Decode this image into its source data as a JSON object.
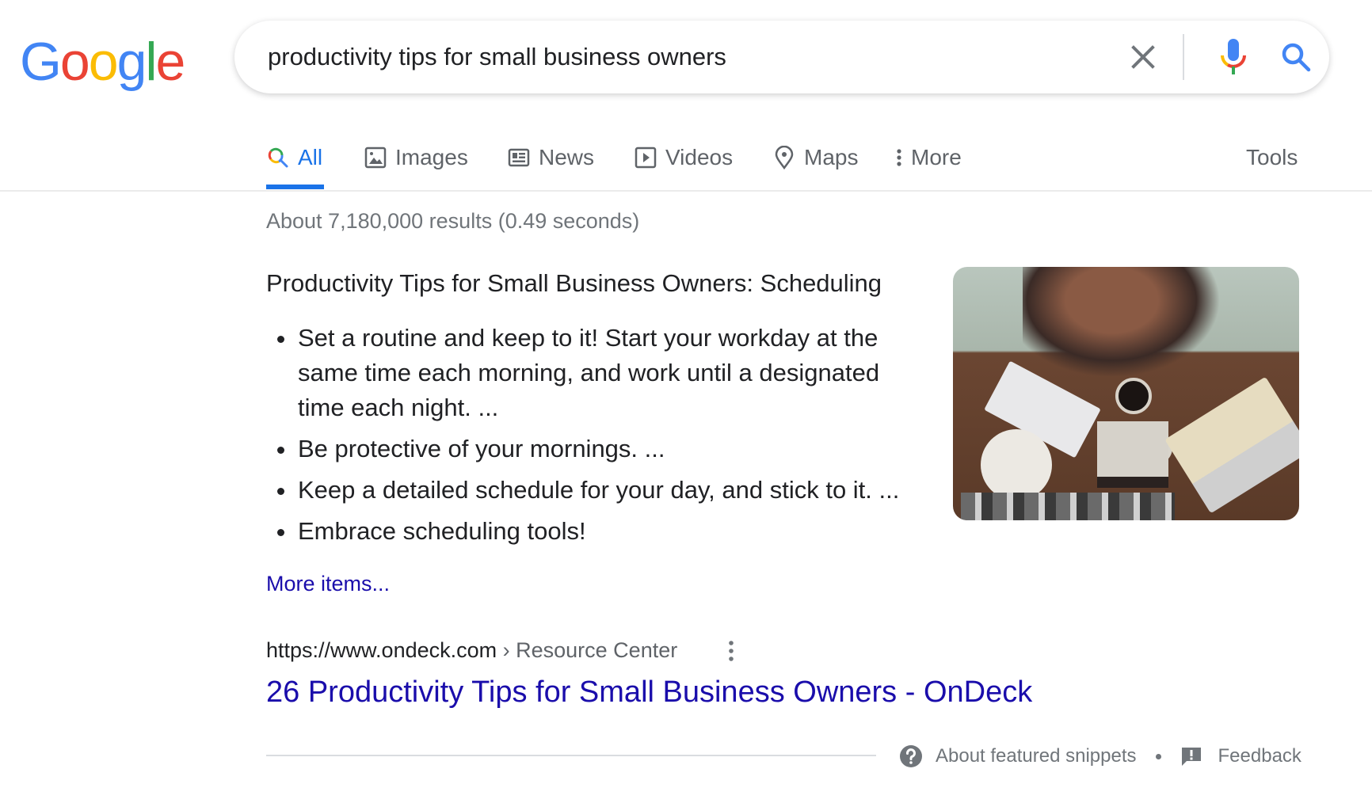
{
  "logo": {
    "letters": [
      {
        "char": "G",
        "color": "#4285f4"
      },
      {
        "char": "o",
        "color": "#ea4335"
      },
      {
        "char": "o",
        "color": "#fbbc05"
      },
      {
        "char": "g",
        "color": "#4285f4"
      },
      {
        "char": "l",
        "color": "#34a853"
      },
      {
        "char": "e",
        "color": "#ea4335"
      }
    ],
    "label": "Google"
  },
  "search": {
    "query": "productivity tips for small business owners",
    "clear_icon": "close-icon",
    "voice_icon": "microphone-icon",
    "search_icon": "search-icon"
  },
  "tabs": [
    {
      "label": "All",
      "icon": "search-icon",
      "active": true
    },
    {
      "label": "Images",
      "icon": "image-icon",
      "active": false
    },
    {
      "label": "News",
      "icon": "newspaper-icon",
      "active": false
    },
    {
      "label": "Videos",
      "icon": "play-icon",
      "active": false
    },
    {
      "label": "Maps",
      "icon": "map-pin-icon",
      "active": false
    },
    {
      "label": "More",
      "icon": "more-vert-icon",
      "active": false
    }
  ],
  "tools_label": "Tools",
  "result_stats": "About 7,180,000 results (0.49 seconds)",
  "featured_snippet": {
    "heading": "Productivity Tips for Small Business Owners: Scheduling",
    "items": [
      "Set a routine and keep to it! Start your workday at the same time each morning, and work until a designated time each night. ...",
      "Be protective of your mornings. ...",
      "Keep a detailed schedule for your day, and stick to it. ...",
      "Embrace scheduling tools!"
    ],
    "more_items_label": "More items...",
    "image_alt": "Man working at a desk with laptop, keyboard and coffee, viewed from above"
  },
  "result": {
    "url_domain": "https://www.ondeck.com",
    "url_breadcrumb": " › Resource Center",
    "title": "26 Productivity Tips for Small Business Owners - OnDeck"
  },
  "footer": {
    "about_label": "About featured snippets",
    "feedback_label": "Feedback"
  },
  "colors": {
    "accent_blue": "#1a73e8",
    "link_blue": "#1a0dab",
    "text_gray": "#70757a"
  }
}
